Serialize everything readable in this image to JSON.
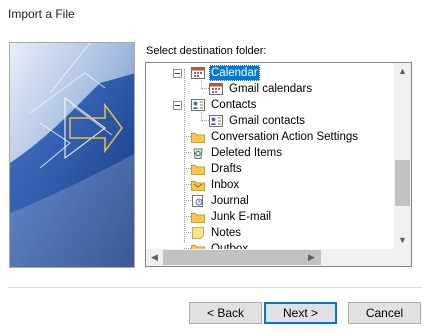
{
  "window": {
    "title": "Import a File"
  },
  "prompt_label": "Select destination folder:",
  "tree": {
    "items": [
      {
        "label": "Calendar",
        "icon": "calendar-icon",
        "selected": true
      },
      {
        "label": "Gmail calendars",
        "icon": "calendar-icon",
        "selected": false
      },
      {
        "label": "Contacts",
        "icon": "contacts-icon",
        "selected": false
      },
      {
        "label": "Gmail contacts",
        "icon": "contacts-icon",
        "selected": false
      },
      {
        "label": "Conversation Action Settings",
        "icon": "folder-icon",
        "selected": false
      },
      {
        "label": "Deleted Items",
        "icon": "recycle-bin-icon",
        "selected": false
      },
      {
        "label": "Drafts",
        "icon": "folder-icon",
        "selected": false
      },
      {
        "label": "Inbox",
        "icon": "inbox-icon",
        "selected": false
      },
      {
        "label": "Journal",
        "icon": "journal-icon",
        "selected": false
      },
      {
        "label": "Junk E-mail",
        "icon": "folder-icon",
        "selected": false
      },
      {
        "label": "Notes",
        "icon": "notes-icon",
        "selected": false
      },
      {
        "label": "Outbox",
        "icon": "outbox-icon",
        "selected": false
      }
    ]
  },
  "buttons": {
    "back": "< Back",
    "next": "Next >",
    "cancel": "Cancel"
  },
  "colors": {
    "selection": "#0078d7",
    "folder": "#f5c94a",
    "art_blue": "#2e5aa8"
  }
}
